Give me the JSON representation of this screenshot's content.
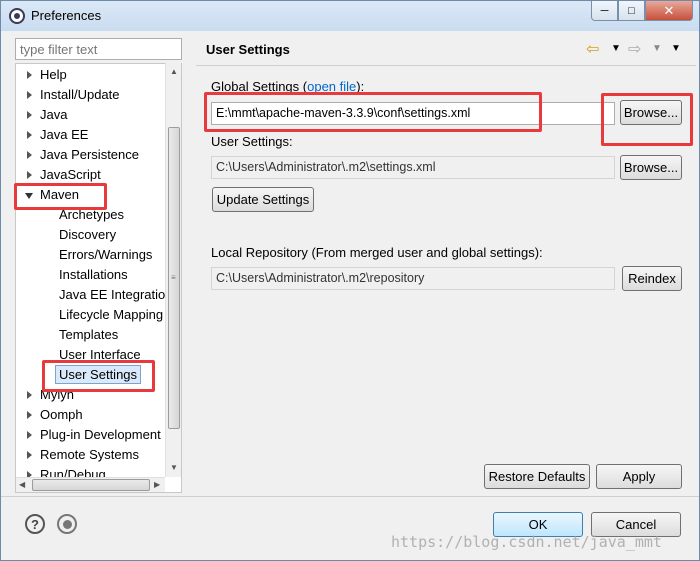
{
  "window": {
    "title": "Preferences",
    "min": "─",
    "max": "□",
    "close": "✕"
  },
  "filter": {
    "placeholder": "type filter text"
  },
  "tree": [
    {
      "label": "Help",
      "level": 0,
      "arrow": "right"
    },
    {
      "label": "Install/Update",
      "level": 0,
      "arrow": "right"
    },
    {
      "label": "Java",
      "level": 0,
      "arrow": "right"
    },
    {
      "label": "Java EE",
      "level": 0,
      "arrow": "right"
    },
    {
      "label": "Java Persistence",
      "level": 0,
      "arrow": "right"
    },
    {
      "label": "JavaScript",
      "level": 0,
      "arrow": "right"
    },
    {
      "label": "Maven",
      "level": 0,
      "arrow": "down"
    },
    {
      "label": "Archetypes",
      "level": 1
    },
    {
      "label": "Discovery",
      "level": 1
    },
    {
      "label": "Errors/Warnings",
      "level": 1
    },
    {
      "label": "Installations",
      "level": 1
    },
    {
      "label": "Java EE Integratior",
      "level": 1
    },
    {
      "label": "Lifecycle Mapping",
      "level": 1
    },
    {
      "label": "Templates",
      "level": 1
    },
    {
      "label": "User Interface",
      "level": 1
    },
    {
      "label": "User Settings",
      "level": 1,
      "selected": true
    },
    {
      "label": "Mylyn",
      "level": 0,
      "arrow": "right"
    },
    {
      "label": "Oomph",
      "level": 0,
      "arrow": "right"
    },
    {
      "label": "Plug-in Development",
      "level": 0,
      "arrow": "right"
    },
    {
      "label": "Remote Systems",
      "level": 0,
      "arrow": "right"
    },
    {
      "label": "Run/Debug",
      "level": 0,
      "arrow": "right"
    }
  ],
  "page": {
    "title": "User Settings",
    "global_label": "Global Settings (",
    "global_link": "open file",
    "global_label_end": "):",
    "global_value": "E:\\mmt\\apache-maven-3.3.9\\conf\\settings.xml",
    "browse": "Browse...",
    "user_label": "User Settings:",
    "user_value": "C:\\Users\\Administrator\\.m2\\settings.xml",
    "update_settings": "Update Settings",
    "local_repo_label": "Local Repository (From merged user and global settings):",
    "local_repo_value": "C:\\Users\\Administrator\\.m2\\repository",
    "reindex": "Reindex",
    "restore_defaults": "Restore Defaults",
    "apply": "Apply"
  },
  "footer": {
    "ok": "OK",
    "cancel": "Cancel"
  },
  "watermark": "https://blog.csdn.net/java_mmt",
  "colors": {
    "highlight_box": "#e8393d",
    "link": "#0066cc",
    "selection": "#d9e8fb"
  }
}
